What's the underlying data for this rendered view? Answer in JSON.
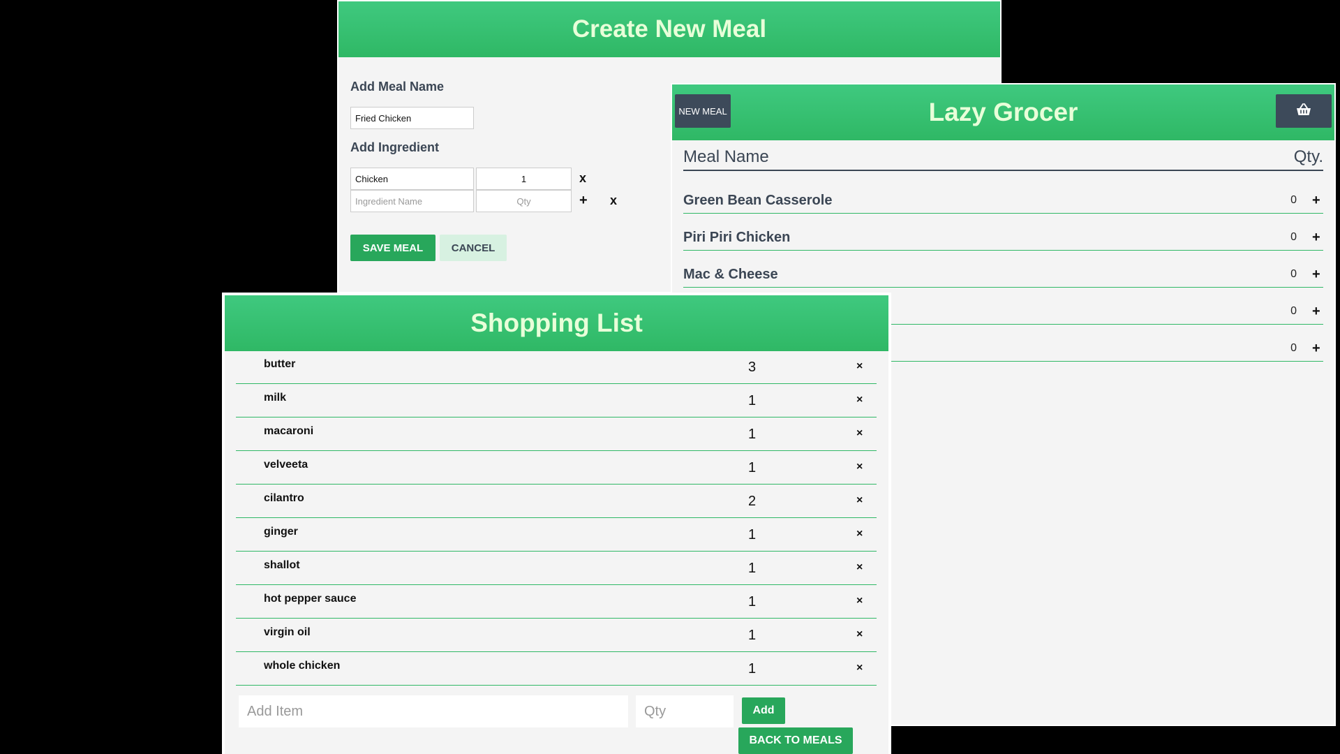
{
  "create_meal": {
    "title": "Create New Meal",
    "meal_name_label": "Add Meal Name",
    "meal_name_value": "Fried Chicken",
    "ingredient_label": "Add Ingredient",
    "ingredients": [
      {
        "name": "Chicken",
        "qty": "1",
        "action": "x"
      }
    ],
    "new_ingredient": {
      "name_placeholder": "Ingredient Name",
      "qty_placeholder": "Qty",
      "add_symbol": "+",
      "remove_symbol": "x"
    },
    "save_label": "SAVE MEAL",
    "cancel_label": "CANCEL"
  },
  "grocer": {
    "title": "Lazy Grocer",
    "new_meal_label": "NEW MEAL",
    "basket_icon": "basket-icon",
    "columns": {
      "name": "Meal Name",
      "qty": "Qty."
    },
    "meals": [
      {
        "name": "Green Bean Casserole",
        "qty": "0",
        "add": "+"
      },
      {
        "name": "Piri Piri Chicken",
        "qty": "0",
        "add": "+"
      },
      {
        "name": "Mac & Cheese",
        "qty": "0",
        "add": "+"
      },
      {
        "name": "",
        "qty": "0",
        "add": "+"
      },
      {
        "name": "",
        "qty": "0",
        "add": "+"
      }
    ]
  },
  "shopping": {
    "title": "Shopping List",
    "remove_symbol": "×",
    "items": [
      {
        "name": "butter",
        "qty": "3"
      },
      {
        "name": "milk",
        "qty": "1"
      },
      {
        "name": "macaroni",
        "qty": "1"
      },
      {
        "name": "velveeta",
        "qty": "1"
      },
      {
        "name": "cilantro",
        "qty": "2"
      },
      {
        "name": "ginger",
        "qty": "1"
      },
      {
        "name": "shallot",
        "qty": "1"
      },
      {
        "name": "hot pepper sauce",
        "qty": "1"
      },
      {
        "name": "virgin oil",
        "qty": "1"
      },
      {
        "name": "whole chicken",
        "qty": "1"
      }
    ],
    "add_item_placeholder": "Add Item",
    "add_qty_placeholder": "Qty",
    "add_label": "Add",
    "back_label": "BACK TO MEALS"
  },
  "colors": {
    "header_green": "#3fc97f",
    "button_green": "#28a75b",
    "dark_slate": "#3d4a5a",
    "title_text": "#e8ffd9"
  }
}
